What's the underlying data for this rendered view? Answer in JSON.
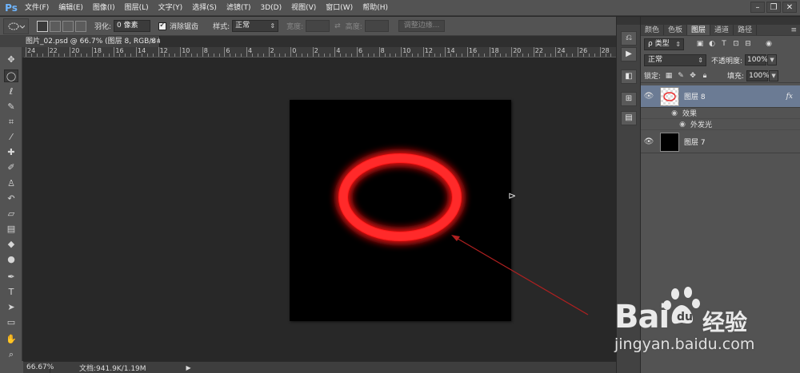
{
  "menubar": {
    "logo": "Ps",
    "items": [
      "文件(F)",
      "编辑(E)",
      "图像(I)",
      "图层(L)",
      "文字(Y)",
      "选择(S)",
      "滤镜(T)",
      "3D(D)",
      "视图(V)",
      "窗口(W)",
      "帮助(H)"
    ],
    "window_controls": [
      "–",
      "❐",
      "✕"
    ]
  },
  "options": {
    "feather_label": "羽化:",
    "feather_value": "0 像素",
    "antialias_label": "消除锯齿",
    "style_label": "样式:",
    "style_value": "正常",
    "width_label": "宽度:",
    "height_label": "高度:",
    "refine_edge_button": "调整边缘..."
  },
  "document": {
    "tab_title": "图片_02.psd @ 66.7% (图层 8, RGB/8#) *",
    "tab_close": "×",
    "zoom": "66.67%",
    "status": "文档:941.9K/1.19M",
    "status_arrow": "▶"
  },
  "ruler": {
    "labels": [
      "24",
      "22",
      "20",
      "18",
      "16",
      "14",
      "12",
      "10",
      "8",
      "6",
      "4",
      "2",
      "0",
      "2",
      "4",
      "6",
      "8",
      "10",
      "12",
      "14",
      "16",
      "18",
      "20",
      "22",
      "24",
      "26",
      "28"
    ]
  },
  "panel": {
    "tabs": [
      "颜色",
      "色板",
      "图层",
      "通道",
      "路径"
    ],
    "active_tab": "图层",
    "menu_icon": "≡",
    "filter_value": "ρ 类型",
    "blend_mode": "正常",
    "opacity_label": "不透明度:",
    "opacity_value": "100%",
    "lock_label": "锁定:",
    "fill_label": "填充:",
    "fill_value": "100%",
    "layers": [
      {
        "name": "图层 8",
        "fx": "fx",
        "selected": true
      },
      {
        "name": "图层 7",
        "selected": false
      }
    ],
    "effects_label": "效果",
    "effect_item": "外发光"
  },
  "watermark": {
    "brand": "Bai",
    "brand_cn": "经验",
    "url": "jingyan.baidu.com"
  },
  "colors": {
    "glow_red": "#ff1a1a",
    "panel_bg": "#535353",
    "selected_layer": "#6b7b94"
  }
}
